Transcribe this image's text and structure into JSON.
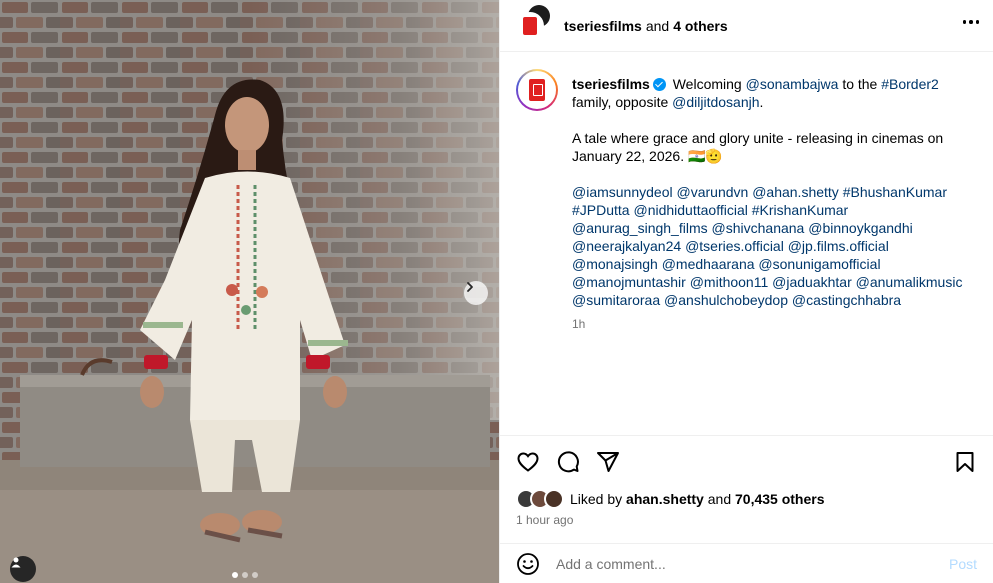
{
  "post": {
    "header": {
      "username": "tseriesfilms",
      "and_text": "and",
      "others_text": "4 others"
    },
    "caption": {
      "username": "tseriesfilms",
      "line1_welcome": "Welcoming",
      "mention_sonam": "@sonambajwa",
      "to_the": "to the",
      "hashtag_border2": "#Border2",
      "family": "family,",
      "opposite": "opposite",
      "mention_diljit": "@diljitdosanjh",
      "period": ".",
      "para2": "A tale where grace and glory unite - releasing in cinemas on January 22, 2026. 🇮🇳🫡",
      "tags": [
        "@iamsunnydeol",
        "@varundvn",
        "@ahan.shetty",
        "#BhushanKumar",
        "#JPDutta",
        "@nidhiduttaofficial",
        "#KrishanKumar",
        "@anurag_singh_films",
        "@shivchanana",
        "@binnoykgandhi",
        "@neerajkalyan24",
        "@tseries.official",
        "@jp.films.official",
        "@monajsingh",
        "@medhaarana",
        "@sonunigamofficial",
        "@manojmuntashir",
        "@mithoon11",
        "@jaduakhtar",
        "@anumalikmusic",
        "@sumitaroraa",
        "@anshulchobeydop",
        "@castingchhabra"
      ],
      "time": "1h"
    },
    "likes": {
      "prefix": "Liked by",
      "user": "ahan.shetty",
      "and_text": "and",
      "count": "70,435 others"
    },
    "time_ago": "1 hour ago",
    "comment": {
      "placeholder": "Add a comment...",
      "post_label": "Post"
    },
    "carousel": {
      "slides": 3,
      "active": 1
    }
  },
  "colors": {
    "link": "#00376b",
    "verified": "#0095f6",
    "muted": "#737373",
    "post_disabled": "#b3dbff",
    "brand_red": "#e02020"
  },
  "icons": [
    "heart-icon",
    "comment-icon",
    "share-icon",
    "bookmark-icon",
    "emoji-icon",
    "more-icon",
    "chevron-right-icon",
    "user-tag-icon",
    "verified-icon"
  ]
}
